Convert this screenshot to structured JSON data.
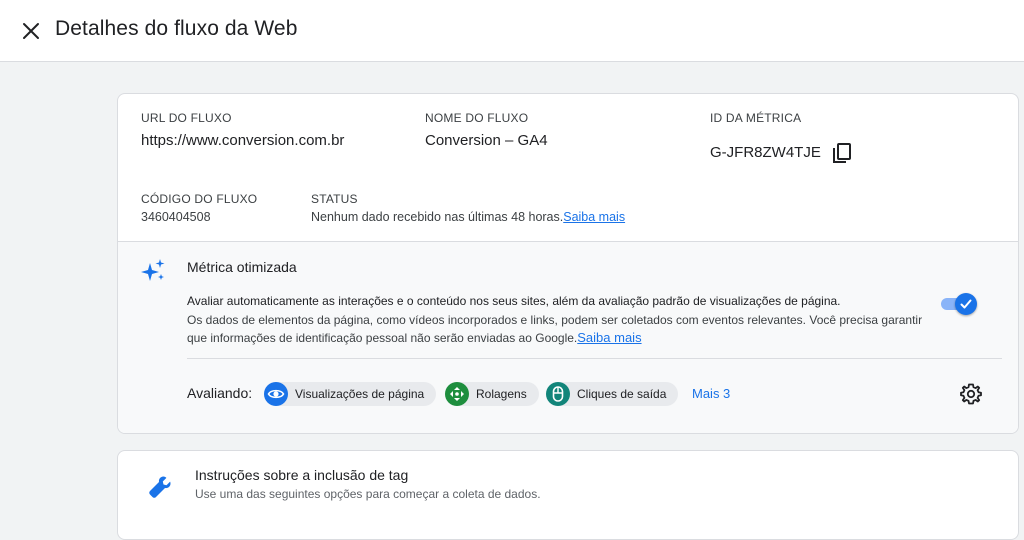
{
  "header": {
    "title": "Detalhes do fluxo da Web",
    "close_icon": "close-icon"
  },
  "details": {
    "url_label": "URL DO FLUXO",
    "url_value": "https://www.conversion.com.br",
    "name_label": "NOME DO FLUXO",
    "name_value": "Conversion – GA4",
    "id_label": "ID DA MÉTRICA",
    "id_value": "G-JFR8ZW4TJE",
    "code_label": "CÓDIGO DO FLUXO",
    "code_value": "3460404508",
    "status_label": "STATUS",
    "status_value": "Nenhum dado recebido nas últimas 48 horas.",
    "status_link": "Saiba mais"
  },
  "enhanced": {
    "title": "Métrica otimizada",
    "desc_line1": "Avaliar automaticamente as interações e o conteúdo nos seus sites, além da avaliação padrão de visualizações de página.",
    "desc_line2": "Os dados de elementos da página, como vídeos incorporados e links, podem ser coletados com eventos relevantes. Você precisa garantir que informações de identificação pessoal não serão enviadas ao Google.",
    "desc_link": "Saiba mais",
    "toggle_on": true,
    "measuring_label": "Avaliando:",
    "chips": [
      {
        "label": "Visualizações de página",
        "icon": "eye-icon",
        "color": "#1a73e8"
      },
      {
        "label": "Rolagens",
        "icon": "scroll-icon",
        "color": "#1e8e3e"
      },
      {
        "label": "Cliques de saída",
        "icon": "mouse-icon",
        "color": "#12857a"
      }
    ],
    "more_label": "Mais 3"
  },
  "tagging": {
    "title": "Instruções sobre a inclusão de tag",
    "subtitle": "Use uma das seguintes opções para começar a coleta de dados."
  },
  "colors": {
    "accent": "#1a73e8",
    "background": "#f1f3f4"
  }
}
